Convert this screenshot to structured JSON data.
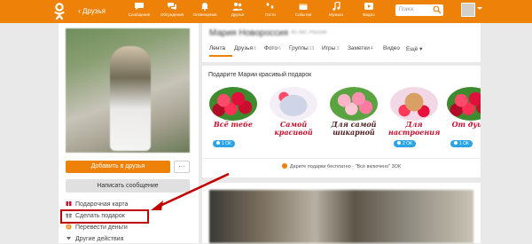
{
  "topbar": {
    "back_label": "Друзья",
    "nav": [
      {
        "label": "Сообщения",
        "icon": "messages-icon"
      },
      {
        "label": "Обсуждения",
        "icon": "discussions-icon"
      },
      {
        "label": "Оповещения",
        "icon": "notifications-icon"
      },
      {
        "label": "Друзья",
        "icon": "friends-icon"
      },
      {
        "label": "Гости",
        "icon": "guests-icon"
      },
      {
        "label": "События",
        "icon": "events-icon"
      },
      {
        "label": "Музыка",
        "icon": "music-icon"
      },
      {
        "label": "Видео",
        "icon": "video-icon"
      }
    ],
    "search_placeholder": "Поиск"
  },
  "left": {
    "add_friend": "Добавить в друзья",
    "more": "···",
    "write_message": "Написать сообщение",
    "actions": [
      "Подарочная карта",
      "Сделать подарок",
      "Перевести деньги",
      "Другие действия"
    ]
  },
  "profile": {
    "name": "Мария Новороссия",
    "name_sub": "40 лет, Россия",
    "tabs": [
      {
        "label": "Лента",
        "count": ""
      },
      {
        "label": "Друзья",
        "count": "6"
      },
      {
        "label": "Фото",
        "count": "6"
      },
      {
        "label": "Группы",
        "count": "13"
      },
      {
        "label": "Игры",
        "count": "3"
      },
      {
        "label": "Заметки",
        "count": "4"
      },
      {
        "label": "Видео",
        "count": ""
      },
      {
        "label": "Ещё ▾",
        "count": ""
      }
    ]
  },
  "gifts": {
    "title": "Подарите Марии красивый подарок",
    "items": [
      {
        "caption": "Всё тебе",
        "badge": "1 ОК"
      },
      {
        "caption": "Самой красивой",
        "badge": ""
      },
      {
        "caption": "Для самой шикарной",
        "badge": ""
      },
      {
        "caption": "Для настроения",
        "badge": "2 ОК"
      },
      {
        "caption": "От души",
        "badge": "1 ОК"
      }
    ],
    "free_note": "Дарите подарки бесплатно - \"Всё включено\" 3ОК"
  },
  "colors": {
    "accent": "#ee8208",
    "highlight": "#c00000",
    "badge": "#2aa3e8"
  }
}
